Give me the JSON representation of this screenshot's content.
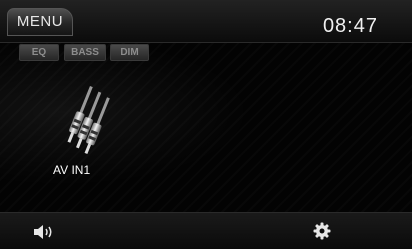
{
  "header": {
    "menu_label": "MENU",
    "clock": "08:47"
  },
  "quick_buttons": {
    "eq": "EQ",
    "bass": "BASS",
    "dim": "DIM"
  },
  "source": {
    "icon": "rca-plugs-icon",
    "label": "AV IN1"
  },
  "footer": {
    "left_icon": "volume-icon",
    "right_icon": "gear-icon"
  }
}
